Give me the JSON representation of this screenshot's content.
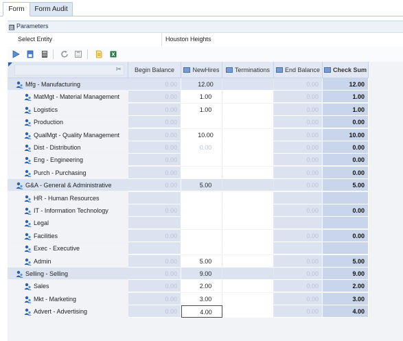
{
  "tabs": [
    {
      "label": "Form",
      "active": true
    },
    {
      "label": "Form Audit",
      "active": false
    }
  ],
  "parameters": {
    "section_title": "Parameters",
    "toggle_symbol": "⊟",
    "label": "Select Entity",
    "value": "Houston Heights"
  },
  "toolbar": {
    "icons": [
      "play-icon",
      "save-icon",
      "calculator-icon",
      "refresh-icon",
      "save-disk-icon",
      "pdf-icon",
      "excel-icon"
    ]
  },
  "grid": {
    "columns": [
      {
        "key": "begin",
        "label": "Begin Balance",
        "icon": false
      },
      {
        "key": "new",
        "label": "NewHires",
        "icon": true
      },
      {
        "key": "term",
        "label": "Terminations",
        "icon": true
      },
      {
        "key": "end",
        "label": "End Balance",
        "icon": true
      },
      {
        "key": "check",
        "label": "Check Sum",
        "icon": true
      }
    ],
    "rows": [
      {
        "label": "Mfg - Manufacturing",
        "parent": true,
        "begin": "0.00",
        "new": "12.00",
        "term": "",
        "end": "0.00",
        "check": "12.00"
      },
      {
        "label": "MatMgt - Material Management",
        "parent": false,
        "begin": "0.00",
        "new": "1.00",
        "term": "",
        "end": "0.00",
        "check": "1.00"
      },
      {
        "label": "Logistics",
        "parent": false,
        "begin": "0.00",
        "new": "1.00",
        "term": "",
        "end": "0.00",
        "check": "1.00"
      },
      {
        "label": "Production",
        "parent": false,
        "begin": "0.00",
        "new": "",
        "term": "",
        "end": "0.00",
        "check": "0.00"
      },
      {
        "label": "QualMgt - Quality Management",
        "parent": false,
        "begin": "0.00",
        "new": "10.00",
        "term": "",
        "end": "0.00",
        "check": "10.00"
      },
      {
        "label": "Dist - Distribution",
        "parent": false,
        "begin": "0.00",
        "new": "0.00",
        "new_muted": true,
        "term": "",
        "end": "0.00",
        "check": "0.00"
      },
      {
        "label": "Eng - Engineering",
        "parent": false,
        "begin": "0.00",
        "new": "",
        "term": "",
        "end": "0.00",
        "check": "0.00"
      },
      {
        "label": "Purch - Purchasing",
        "parent": false,
        "begin": "0.00",
        "new": "",
        "term": "",
        "end": "0.00",
        "check": "0.00"
      },
      {
        "label": "G&A - General & Administrative",
        "parent": true,
        "begin": "0.00",
        "new": "5.00",
        "term": "",
        "end": "0.00",
        "check": "5.00"
      },
      {
        "label": "HR - Human Resources",
        "parent": false,
        "begin": "",
        "new": "",
        "term": "",
        "end": "",
        "check": ""
      },
      {
        "label": "IT - Information Technology",
        "parent": false,
        "begin": "0.00",
        "new": "",
        "term": "",
        "end": "0.00",
        "check": "0.00"
      },
      {
        "label": "Legal",
        "parent": false,
        "begin": "",
        "new": "",
        "term": "",
        "end": "",
        "check": ""
      },
      {
        "label": "Facilities",
        "parent": false,
        "begin": "0.00",
        "new": "",
        "term": "",
        "end": "0.00",
        "check": "0.00"
      },
      {
        "label": "Exec - Executive",
        "parent": false,
        "begin": "",
        "new": "",
        "term": "",
        "end": "",
        "check": ""
      },
      {
        "label": "Admin",
        "parent": false,
        "begin": "0.00",
        "new": "5.00",
        "term": "",
        "end": "0.00",
        "check": "5.00"
      },
      {
        "label": "Selling - Selling",
        "parent": true,
        "begin": "0.00",
        "new": "9.00",
        "term": "",
        "end": "0.00",
        "check": "9.00"
      },
      {
        "label": "Sales",
        "parent": false,
        "begin": "0.00",
        "new": "2.00",
        "term": "",
        "end": "0.00",
        "check": "2.00"
      },
      {
        "label": "Mkt - Marketing",
        "parent": false,
        "begin": "0.00",
        "new": "3.00",
        "term": "",
        "end": "0.00",
        "check": "3.00"
      },
      {
        "label": "Advert - Advertising",
        "parent": false,
        "begin": "0.00",
        "new": "4.00",
        "new_editing": true,
        "term": "",
        "end": "0.00",
        "check": "4.00"
      }
    ]
  },
  "colors": {
    "header_bg": "#e2e8f3",
    "parent_bg": "#dbe3f1",
    "check_bg": "#c9d5ea",
    "muted_text": "#b9c3d3"
  }
}
